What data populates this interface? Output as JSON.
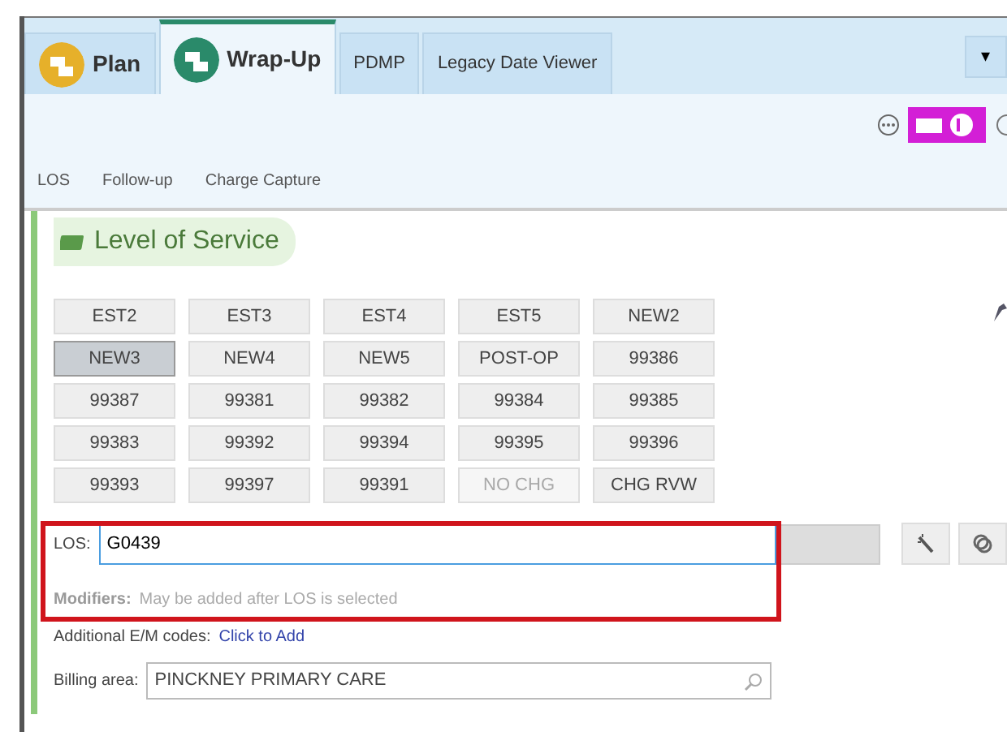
{
  "tabs": [
    {
      "label": "Plan",
      "selected": false,
      "kind": "icon"
    },
    {
      "label": "Wrap-Up",
      "selected": true,
      "kind": "icon"
    },
    {
      "label": "PDMP",
      "selected": false,
      "kind": "plain"
    },
    {
      "label": "Legacy Date Viewer",
      "selected": false,
      "kind": "plain"
    }
  ],
  "tab_menu": "▾",
  "subtabs": [
    "LOS",
    "Follow-up",
    "Charge Capture"
  ],
  "section": {
    "title": "Level of Service"
  },
  "los_buttons": [
    {
      "label": "EST2",
      "selected": false,
      "disabled": false
    },
    {
      "label": "EST3",
      "selected": false,
      "disabled": false
    },
    {
      "label": "EST4",
      "selected": false,
      "disabled": false
    },
    {
      "label": "EST5",
      "selected": false,
      "disabled": false
    },
    {
      "label": "NEW2",
      "selected": false,
      "disabled": false
    },
    {
      "label": "NEW3",
      "selected": true,
      "disabled": false
    },
    {
      "label": "NEW4",
      "selected": false,
      "disabled": false
    },
    {
      "label": "NEW5",
      "selected": false,
      "disabled": false
    },
    {
      "label": "POST-OP",
      "selected": false,
      "disabled": false
    },
    {
      "label": "99386",
      "selected": false,
      "disabled": false
    },
    {
      "label": "99387",
      "selected": false,
      "disabled": false
    },
    {
      "label": "99381",
      "selected": false,
      "disabled": false
    },
    {
      "label": "99382",
      "selected": false,
      "disabled": false
    },
    {
      "label": "99384",
      "selected": false,
      "disabled": false
    },
    {
      "label": "99385",
      "selected": false,
      "disabled": false
    },
    {
      "label": "99383",
      "selected": false,
      "disabled": false
    },
    {
      "label": "99392",
      "selected": false,
      "disabled": false
    },
    {
      "label": "99394",
      "selected": false,
      "disabled": false
    },
    {
      "label": "99395",
      "selected": false,
      "disabled": false
    },
    {
      "label": "99396",
      "selected": false,
      "disabled": false
    },
    {
      "label": "99393",
      "selected": false,
      "disabled": false
    },
    {
      "label": "99397",
      "selected": false,
      "disabled": false
    },
    {
      "label": "99391",
      "selected": false,
      "disabled": false
    },
    {
      "label": "NO CHG",
      "selected": false,
      "disabled": true
    },
    {
      "label": "CHG RVW",
      "selected": false,
      "disabled": false
    }
  ],
  "los_field": {
    "label": "LOS:",
    "value": "G0439"
  },
  "modifiers": {
    "label": "Modifiers:",
    "hint": "May be added after LOS is selected"
  },
  "additional": {
    "label": "Additional E/M codes:",
    "link": "Click to Add"
  },
  "billing": {
    "label": "Billing area:",
    "value": "PINCKNEY PRIMARY CARE"
  }
}
